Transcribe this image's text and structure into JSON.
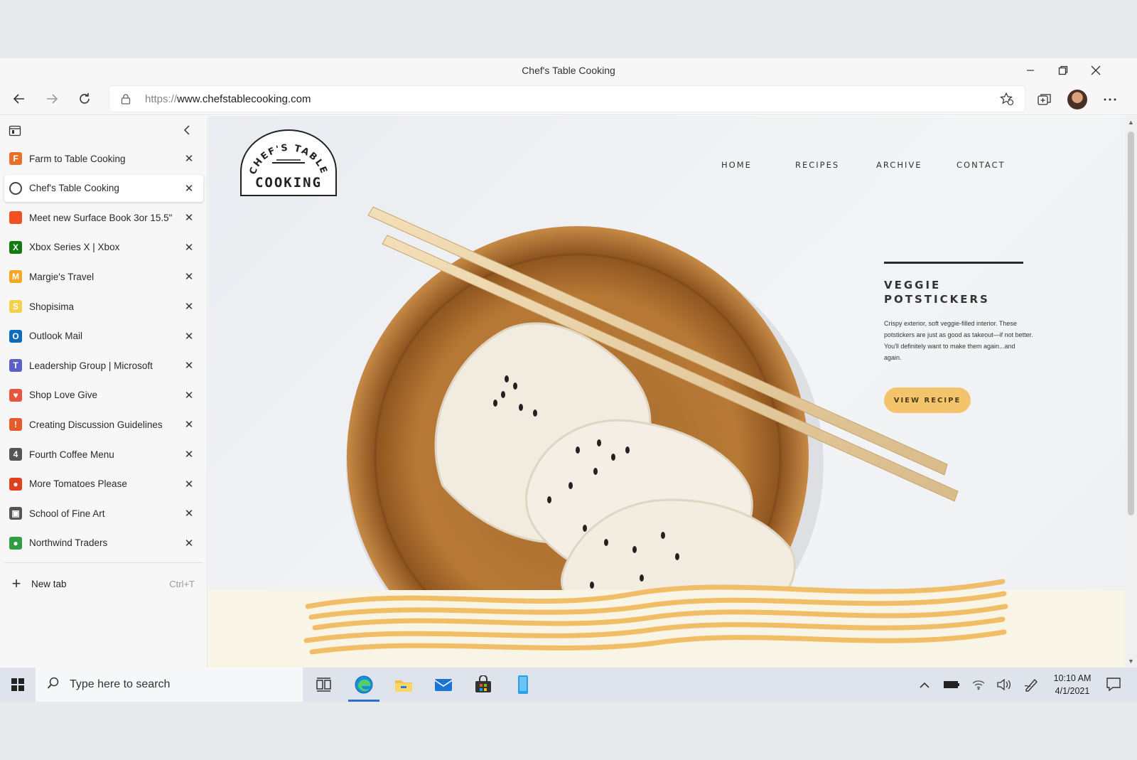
{
  "window": {
    "title": "Chef's Table Cooking",
    "controls": [
      "minimize-icon",
      "restore-icon",
      "close-icon"
    ]
  },
  "toolbar": {
    "url_protocol": "https://",
    "url_host": "www.chefstablecooking.com",
    "icons": [
      "back-icon",
      "forward-icon",
      "refresh-icon",
      "lock-icon",
      "favorites-add-icon",
      "collections-icon",
      "profile-avatar",
      "more-icon"
    ]
  },
  "sidebar": {
    "tabs": [
      {
        "label": "Farm to Table Cooking",
        "icon": "farm-to-table-favicon",
        "color": "#e8702a",
        "glyph": "F"
      },
      {
        "label": "Chef's Table Cooking",
        "icon": "chefs-table-favicon",
        "color": "#ffffff",
        "glyph": "",
        "active": true
      },
      {
        "label": "Meet new Surface Book 3or 15.5\"",
        "icon": "microsoft-favicon",
        "color": "#f25022",
        "glyph": ""
      },
      {
        "label": "Xbox Series X | Xbox",
        "icon": "xbox-favicon",
        "color": "#107c10",
        "glyph": "X"
      },
      {
        "label": "Margie's Travel",
        "icon": "margies-travel-favicon",
        "color": "#f5a623",
        "glyph": "M"
      },
      {
        "label": "Shopisima",
        "icon": "shopisima-favicon",
        "color": "#f2d14b",
        "glyph": "S"
      },
      {
        "label": "Outlook Mail",
        "icon": "outlook-favicon",
        "color": "#0f6cbd",
        "glyph": "O"
      },
      {
        "label": "Leadership Group | Microsoft",
        "icon": "teams-favicon",
        "color": "#5b5fc7",
        "glyph": "T"
      },
      {
        "label": "Shop Love Give",
        "icon": "shop-love-give-favicon",
        "color": "#e8553a",
        "glyph": "♥"
      },
      {
        "label": "Creating Discussion Guidelines",
        "icon": "discussion-favicon",
        "color": "#e85a2a",
        "glyph": "!"
      },
      {
        "label": "Fourth Coffee Menu",
        "icon": "fourth-coffee-favicon",
        "color": "#555555",
        "glyph": "4"
      },
      {
        "label": "More Tomatoes Please",
        "icon": "tomato-favicon",
        "color": "#e0401e",
        "glyph": "●"
      },
      {
        "label": "School of Fine Art",
        "icon": "fine-art-favicon",
        "color": "#555555",
        "glyph": "▣"
      },
      {
        "label": "Northwind Traders",
        "icon": "northwind-favicon",
        "color": "#2e9e44",
        "glyph": "●"
      }
    ],
    "new_tab_label": "New tab",
    "new_tab_shortcut": "Ctrl+T"
  },
  "page": {
    "logo_arc": "CHEF'S TABLE",
    "logo_word": "COOKING",
    "nav": [
      "HOME",
      "RECIPES",
      "ARCHIVE",
      "CONTACT"
    ],
    "headline_line1": "VEGGIE",
    "headline_line2": "POTSTICKERS",
    "blurb": "Crispy exterior, soft veggie-filled interior. These potstickers are just as good as takeout—if not better. You'll definitely want to make them again...and again.",
    "cta": "VIEW RECIPE",
    "accent_color": "#f4c46c"
  },
  "taskbar": {
    "search_placeholder": "Type here to search",
    "time": "10:10 AM",
    "date": "4/1/2021",
    "apps": [
      "task-view-icon",
      "edge-icon",
      "file-explorer-icon",
      "mail-icon",
      "store-icon",
      "phone-icon"
    ],
    "tray": [
      "chevron-up-icon",
      "battery-icon",
      "wifi-icon",
      "volume-icon",
      "pen-icon"
    ]
  }
}
